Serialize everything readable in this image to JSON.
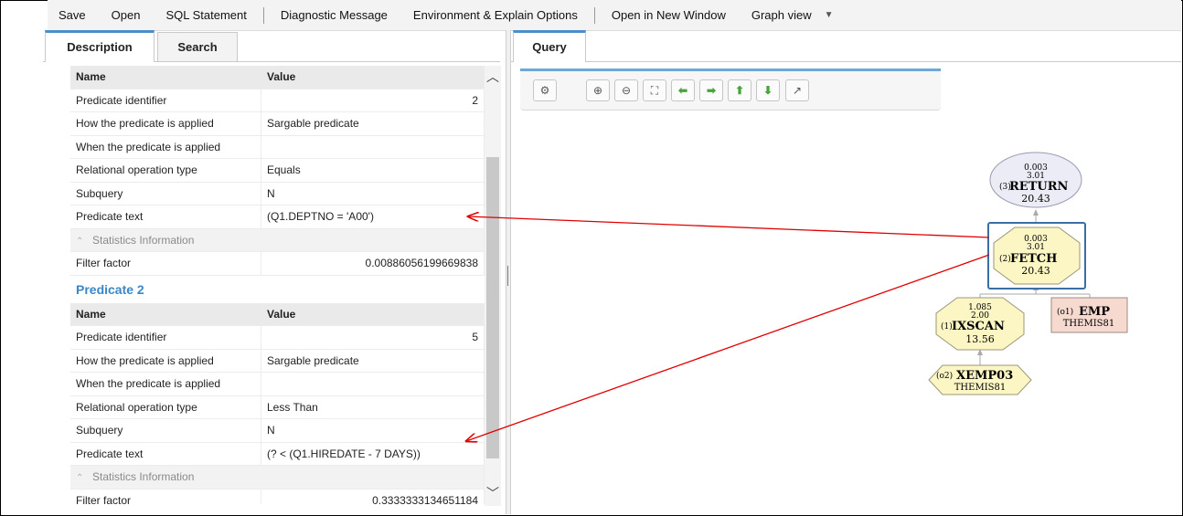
{
  "toolbar": {
    "save": "Save",
    "open": "Open",
    "sql_statement": "SQL Statement",
    "diagnostic_message": "Diagnostic Message",
    "env_explain": "Environment & Explain Options",
    "open_new_window": "Open in New Window",
    "graph_view": "Graph view"
  },
  "left_tabs": {
    "description": "Description",
    "search": "Search"
  },
  "predicate1": {
    "header": {
      "name": "Name",
      "value": "Value"
    },
    "rows": [
      {
        "name": "Predicate identifier",
        "value": "2"
      },
      {
        "name": "How the predicate is applied",
        "value": "Sargable predicate"
      },
      {
        "name": "When the predicate is applied",
        "value": ""
      },
      {
        "name": "Relational operation type",
        "value": "Equals"
      },
      {
        "name": "Subquery",
        "value": "N"
      },
      {
        "name": "Predicate text",
        "value": "(Q1.DEPTNO = 'A00')"
      }
    ],
    "stats_label": "Statistics Information",
    "filter_factor": {
      "name": "Filter factor",
      "value": "0.00886056199669838"
    }
  },
  "predicate2": {
    "title": "Predicate 2",
    "header": {
      "name": "Name",
      "value": "Value"
    },
    "rows": [
      {
        "name": "Predicate identifier",
        "value": "5"
      },
      {
        "name": "How the predicate is applied",
        "value": "Sargable predicate"
      },
      {
        "name": "When the predicate is applied",
        "value": ""
      },
      {
        "name": "Relational operation type",
        "value": "Less Than"
      },
      {
        "name": "Subquery",
        "value": "N"
      },
      {
        "name": "Predicate text",
        "value": "(? < (Q1.HIREDATE - 7 DAYS))"
      }
    ],
    "stats_label": "Statistics Information",
    "filter_factor": {
      "name": "Filter factor",
      "value": "0.3333333134651184"
    }
  },
  "query_tab": "Query",
  "graph_toolbar_icons": [
    "graph-options-icon",
    "zoom-in-icon",
    "zoom-out-icon",
    "fit-icon",
    "arrow-left-icon",
    "arrow-right-icon",
    "arrow-up-icon",
    "arrow-down-icon",
    "export-icon"
  ],
  "graph": {
    "return": {
      "cost1": "0.003",
      "cost2": "3.01",
      "num": "(3)",
      "name": "RETURN",
      "total": "20.43"
    },
    "fetch": {
      "cost1": "0.003",
      "cost2": "3.01",
      "num": "(2)",
      "name": "FETCH",
      "total": "20.43"
    },
    "ixscan": {
      "cost1": "1.085",
      "cost2": "2.00",
      "num": "(1)",
      "name": "IXSCAN",
      "total": "13.56"
    },
    "emp": {
      "num": "(o1)",
      "name": "EMP",
      "schema": "THEMIS81"
    },
    "xemp03": {
      "num": "(o2)",
      "name": "XEMP03",
      "schema": "THEMIS81"
    }
  },
  "colors": {
    "accent": "#4a8fcc",
    "link": "#3a87c8",
    "annotation_arrow": "#e00000",
    "node_yellow": "#fbf6c4",
    "node_return": "#ececf7",
    "node_table": "#f6d9cf"
  }
}
